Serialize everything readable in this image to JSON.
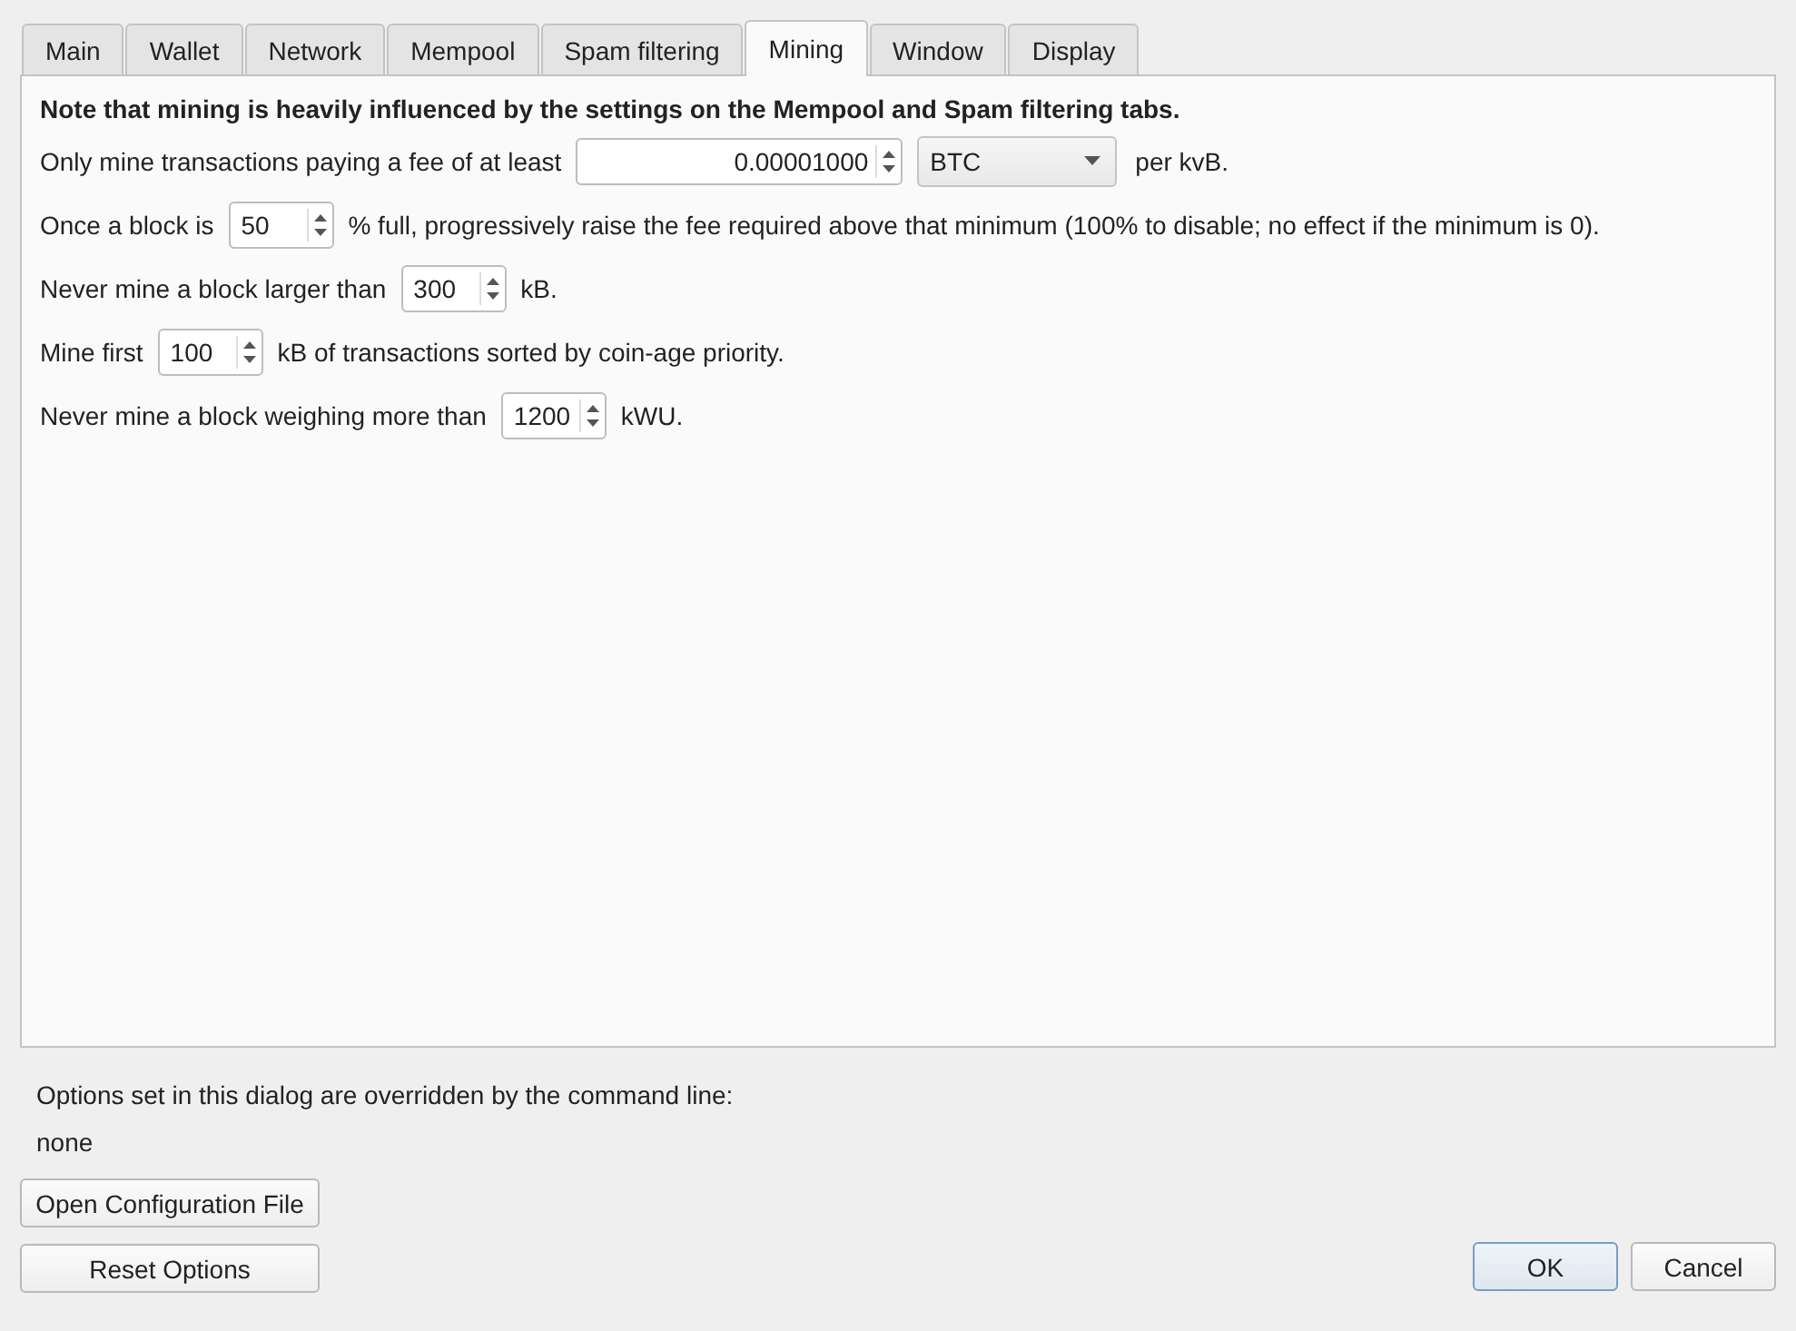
{
  "tabs": [
    {
      "label": "Main",
      "selected": false
    },
    {
      "label": "Wallet",
      "selected": false
    },
    {
      "label": "Network",
      "selected": false
    },
    {
      "label": "Mempool",
      "selected": false
    },
    {
      "label": "Spam filtering",
      "selected": false
    },
    {
      "label": "Mining",
      "selected": true
    },
    {
      "label": "Window",
      "selected": false
    },
    {
      "label": "Display",
      "selected": false
    }
  ],
  "note": "Note that mining is heavily influenced by the settings on the Mempool and Spam filtering tabs.",
  "rows": [
    [
      {
        "kind": "text",
        "text": "Only mine transactions paying a fee of at least"
      },
      {
        "kind": "amount",
        "value": "0.00001000"
      },
      {
        "kind": "combo",
        "value": "BTC"
      },
      {
        "kind": "text",
        "text": "per kvB."
      }
    ],
    [
      {
        "kind": "text",
        "text": "Once a block is"
      },
      {
        "kind": "spin",
        "value": "50"
      },
      {
        "kind": "text",
        "text": "% full, progressively raise the fee required above that minimum (100% to disable; no effect if the minimum is 0)."
      }
    ],
    [
      {
        "kind": "text",
        "text": "Never mine a block larger than"
      },
      {
        "kind": "spin",
        "value": "300"
      },
      {
        "kind": "text",
        "text": "kB."
      }
    ],
    [
      {
        "kind": "text",
        "text": "Mine first"
      },
      {
        "kind": "spin",
        "value": "100"
      },
      {
        "kind": "text",
        "text": "kB of transactions sorted by coin-age priority."
      }
    ],
    [
      {
        "kind": "text",
        "text": "Never mine a block weighing more than"
      },
      {
        "kind": "spin",
        "value": "1200"
      },
      {
        "kind": "text",
        "text": "kWU."
      }
    ]
  ],
  "override_label": "Options set in this dialog are overridden by the command line:",
  "override_value": "none",
  "left_buttons": [
    "Open Configuration File",
    "Reset Options"
  ],
  "ok_button": "OK",
  "cancel_button": "Cancel"
}
